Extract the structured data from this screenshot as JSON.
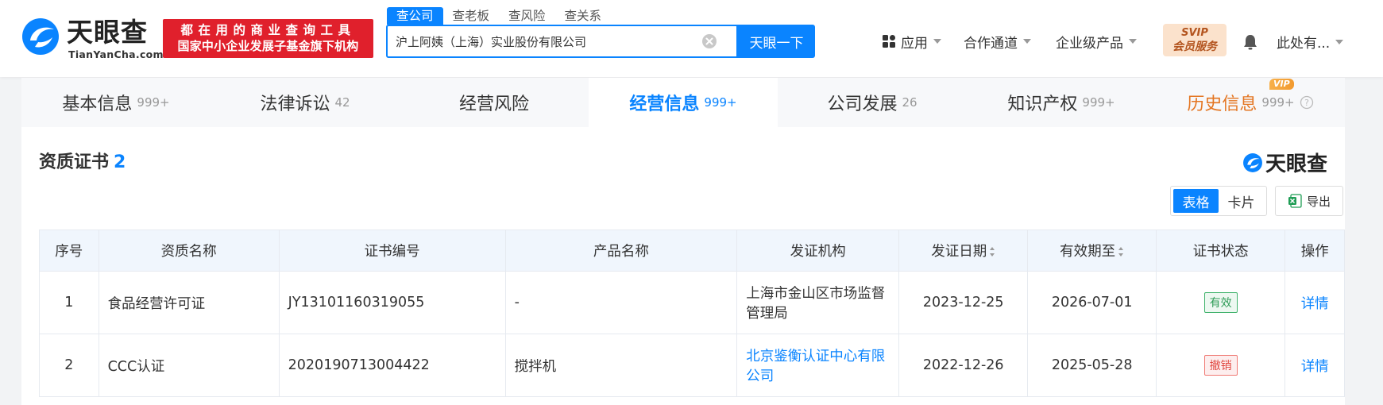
{
  "brand": {
    "name_cn": "天眼查",
    "name_en": "TianYanCha.com",
    "slogan_line1": "都在用的商业查询工具",
    "slogan_line2": "国家中小企业发展子基金旗下机构"
  },
  "search": {
    "tabs": [
      "查公司",
      "查老板",
      "查风险",
      "查关系"
    ],
    "active_tab": "查公司",
    "value": "沪上阿姨（上海）实业股份有限公司",
    "button": "天眼一下"
  },
  "nav": {
    "apps": "应用",
    "cooperation": "合作通道",
    "enterprise": "企业级产品",
    "svip_top": "SVIP",
    "svip_bottom": "会员服务",
    "user": "此处有..."
  },
  "tabs": [
    {
      "label": "基本信息",
      "count": "999+"
    },
    {
      "label": "法律诉讼",
      "count": "42"
    },
    {
      "label": "经营风险",
      "count": ""
    },
    {
      "label": "经营信息",
      "count": "999+"
    },
    {
      "label": "公司发展",
      "count": "26"
    },
    {
      "label": "知识产权",
      "count": "999+"
    },
    {
      "label": "历史信息",
      "count": "999+"
    }
  ],
  "vip_badge": "VIP",
  "section": {
    "title": "资质证书",
    "count": "2",
    "brand": "天眼查",
    "view_table": "表格",
    "view_card": "卡片",
    "export": "导出"
  },
  "table": {
    "headers": [
      "序号",
      "资质名称",
      "证书编号",
      "产品名称",
      "发证机构",
      "发证日期",
      "有效期至",
      "证书状态",
      "操作"
    ],
    "rows": [
      {
        "no": "1",
        "name": "食品经营许可证",
        "cert_no": "JY13101160319055",
        "product": "-",
        "issuer": "上海市金山区市场监督管理局",
        "issue_date": "2023-12-25",
        "valid_until": "2026-07-01",
        "status": "有效",
        "action": "详情"
      },
      {
        "no": "2",
        "name": "CCC认证",
        "cert_no": "2020190713004422",
        "product": "搅拌机",
        "issuer": "北京鉴衡认证中心有限公司",
        "issue_date": "2022-12-26",
        "valid_until": "2025-05-28",
        "status": "撤销",
        "action": "详情"
      }
    ]
  },
  "colors": {
    "accent": "#0a84ff",
    "slogan_bg": "#e0202c",
    "history_tab": "#e47622",
    "status_valid": "#2e9c57",
    "status_revoked": "#e0463f"
  }
}
